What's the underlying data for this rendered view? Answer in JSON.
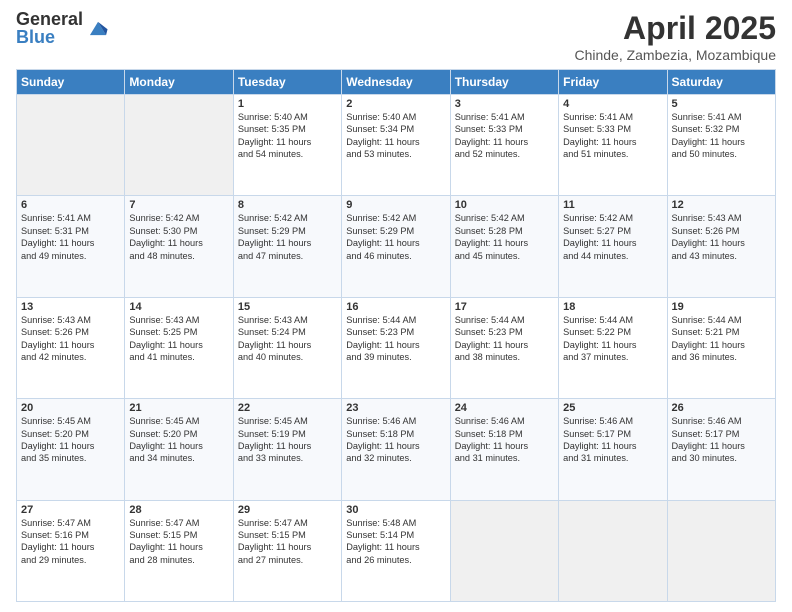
{
  "logo": {
    "general": "General",
    "blue": "Blue"
  },
  "title": "April 2025",
  "subtitle": "Chinde, Zambezia, Mozambique",
  "days": [
    "Sunday",
    "Monday",
    "Tuesday",
    "Wednesday",
    "Thursday",
    "Friday",
    "Saturday"
  ],
  "weeks": [
    [
      {
        "day": "",
        "empty": true
      },
      {
        "day": "",
        "empty": true
      },
      {
        "day": "1",
        "sunrise": "5:40 AM",
        "sunset": "5:35 PM",
        "daylight": "11 hours and 54 minutes."
      },
      {
        "day": "2",
        "sunrise": "5:40 AM",
        "sunset": "5:34 PM",
        "daylight": "11 hours and 53 minutes."
      },
      {
        "day": "3",
        "sunrise": "5:41 AM",
        "sunset": "5:33 PM",
        "daylight": "11 hours and 52 minutes."
      },
      {
        "day": "4",
        "sunrise": "5:41 AM",
        "sunset": "5:33 PM",
        "daylight": "11 hours and 51 minutes."
      },
      {
        "day": "5",
        "sunrise": "5:41 AM",
        "sunset": "5:32 PM",
        "daylight": "11 hours and 50 minutes."
      }
    ],
    [
      {
        "day": "6",
        "sunrise": "5:41 AM",
        "sunset": "5:31 PM",
        "daylight": "11 hours and 49 minutes."
      },
      {
        "day": "7",
        "sunrise": "5:42 AM",
        "sunset": "5:30 PM",
        "daylight": "11 hours and 48 minutes."
      },
      {
        "day": "8",
        "sunrise": "5:42 AM",
        "sunset": "5:29 PM",
        "daylight": "11 hours and 47 minutes."
      },
      {
        "day": "9",
        "sunrise": "5:42 AM",
        "sunset": "5:29 PM",
        "daylight": "11 hours and 46 minutes."
      },
      {
        "day": "10",
        "sunrise": "5:42 AM",
        "sunset": "5:28 PM",
        "daylight": "11 hours and 45 minutes."
      },
      {
        "day": "11",
        "sunrise": "5:42 AM",
        "sunset": "5:27 PM",
        "daylight": "11 hours and 44 minutes."
      },
      {
        "day": "12",
        "sunrise": "5:43 AM",
        "sunset": "5:26 PM",
        "daylight": "11 hours and 43 minutes."
      }
    ],
    [
      {
        "day": "13",
        "sunrise": "5:43 AM",
        "sunset": "5:26 PM",
        "daylight": "11 hours and 42 minutes."
      },
      {
        "day": "14",
        "sunrise": "5:43 AM",
        "sunset": "5:25 PM",
        "daylight": "11 hours and 41 minutes."
      },
      {
        "day": "15",
        "sunrise": "5:43 AM",
        "sunset": "5:24 PM",
        "daylight": "11 hours and 40 minutes."
      },
      {
        "day": "16",
        "sunrise": "5:44 AM",
        "sunset": "5:23 PM",
        "daylight": "11 hours and 39 minutes."
      },
      {
        "day": "17",
        "sunrise": "5:44 AM",
        "sunset": "5:23 PM",
        "daylight": "11 hours and 38 minutes."
      },
      {
        "day": "18",
        "sunrise": "5:44 AM",
        "sunset": "5:22 PM",
        "daylight": "11 hours and 37 minutes."
      },
      {
        "day": "19",
        "sunrise": "5:44 AM",
        "sunset": "5:21 PM",
        "daylight": "11 hours and 36 minutes."
      }
    ],
    [
      {
        "day": "20",
        "sunrise": "5:45 AM",
        "sunset": "5:20 PM",
        "daylight": "11 hours and 35 minutes."
      },
      {
        "day": "21",
        "sunrise": "5:45 AM",
        "sunset": "5:20 PM",
        "daylight": "11 hours and 34 minutes."
      },
      {
        "day": "22",
        "sunrise": "5:45 AM",
        "sunset": "5:19 PM",
        "daylight": "11 hours and 33 minutes."
      },
      {
        "day": "23",
        "sunrise": "5:46 AM",
        "sunset": "5:18 PM",
        "daylight": "11 hours and 32 minutes."
      },
      {
        "day": "24",
        "sunrise": "5:46 AM",
        "sunset": "5:18 PM",
        "daylight": "11 hours and 31 minutes."
      },
      {
        "day": "25",
        "sunrise": "5:46 AM",
        "sunset": "5:17 PM",
        "daylight": "11 hours and 31 minutes."
      },
      {
        "day": "26",
        "sunrise": "5:46 AM",
        "sunset": "5:17 PM",
        "daylight": "11 hours and 30 minutes."
      }
    ],
    [
      {
        "day": "27",
        "sunrise": "5:47 AM",
        "sunset": "5:16 PM",
        "daylight": "11 hours and 29 minutes."
      },
      {
        "day": "28",
        "sunrise": "5:47 AM",
        "sunset": "5:15 PM",
        "daylight": "11 hours and 28 minutes."
      },
      {
        "day": "29",
        "sunrise": "5:47 AM",
        "sunset": "5:15 PM",
        "daylight": "11 hours and 27 minutes."
      },
      {
        "day": "30",
        "sunrise": "5:48 AM",
        "sunset": "5:14 PM",
        "daylight": "11 hours and 26 minutes."
      },
      {
        "day": "",
        "empty": true
      },
      {
        "day": "",
        "empty": true
      },
      {
        "day": "",
        "empty": true
      }
    ]
  ]
}
